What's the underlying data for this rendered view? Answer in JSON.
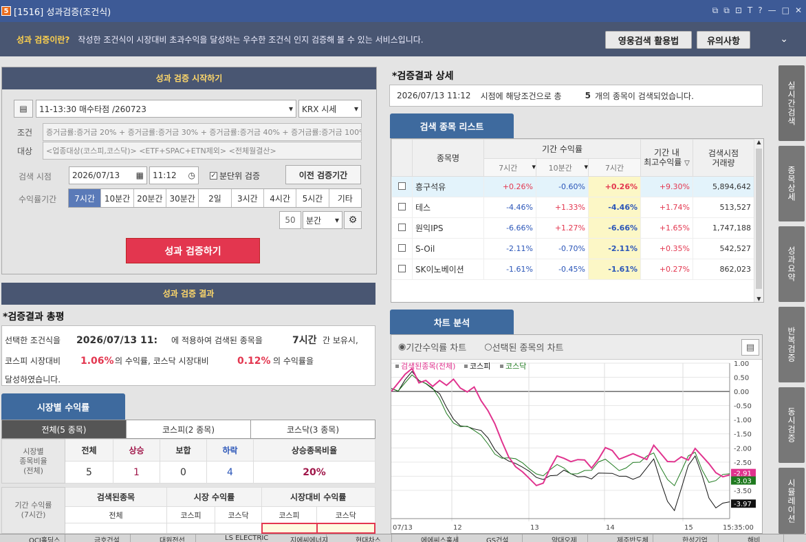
{
  "window": {
    "number": "5",
    "title": "[1516] 성과검증(조건식)",
    "icons": [
      "⧉",
      "⧉",
      "⊡",
      "T",
      "?",
      "—",
      "□",
      "✕"
    ]
  },
  "info": {
    "question": "성과 검증이란?",
    "desc": "작성한 조건식이 시장대비 초과수익을 달성하는 우수한 조건식 인지 검증해 볼 수 있는 서비스입니다.",
    "btn_video": "영웅검색 활용법",
    "btn_caution": "유의사항",
    "collapse": "⌄"
  },
  "start": {
    "header": "성과 검증 시작하기",
    "formula": "11-13:30 매수타점 /260723",
    "price_type": "KRX 시세",
    "cond_label": "조건",
    "cond_value": "증거금률:증거금 20% + 증거금률:증거금 30% + 증거금률:증거금 40% + 증거금률:증거금 100% + 주가범위",
    "target_label": "대상",
    "target_value": "<업종대상(코스피,코스닥)> <ETF+SPAC+ETN제외> <전체월결산>",
    "search_time_label": "검색 시점",
    "date": "2026/07/13",
    "time": "11:12",
    "minute_check": "분단위 검증",
    "prev_btn": "이전 검증기간",
    "period_label": "수익률기간",
    "periods": [
      "7시간",
      "10분간",
      "20분간",
      "30분간",
      "2일",
      "3시간",
      "4시간",
      "5시간",
      "기타"
    ],
    "custom_num": "50",
    "custom_unit": "분간",
    "run_btn": "성과 검증하기"
  },
  "result": {
    "header": "성과 검증 결과",
    "summary_title": "*검증결과 총평",
    "line1_pre": "선택한 조건식을",
    "line1_date": "2026/07/13  11:",
    "line1_mid": "에 적용하여 검색된 종목을",
    "line1_period": "7시간",
    "line1_post": "간 보유시,",
    "line2_pre": "코스피 시장대비",
    "line2_kospi": "1.06%",
    "line2_mid": "의 수익률, 코스닥 시장대비",
    "line2_kosdaq": "0.12%",
    "line2_post": "의 수익률을",
    "line3": "달성하였습니다."
  },
  "market": {
    "tab": "시장별 수익률",
    "subtabs": [
      "전체(5 종목)",
      "코스피(2 종목)",
      "코스닥(3 종목)"
    ],
    "row_label": "시장별\n종목비율\n(전체)",
    "headers": [
      "전체",
      "상승",
      "보합",
      "하락",
      "상승종목비율"
    ],
    "values": [
      "5",
      "1",
      "0",
      "4",
      "20%"
    ],
    "period_label": "기간 수익률\n(7시간)",
    "h2": [
      "검색된종목",
      "시장 수익률",
      "시장대비 수익률"
    ],
    "h3": [
      "전체",
      "코스피",
      "코스닥",
      "코스피",
      "코스닥"
    ]
  },
  "detail": {
    "title": "*검증결과 상세",
    "date": "2026/07/13 11:12",
    "text1": "시점에 해당조건으로 총",
    "count": "5",
    "text2": "개의 종목이 검색되었습니다."
  },
  "stock_list": {
    "tab": "검색 종목 리스트",
    "h_name": "종목명",
    "h_period": "기간 수익률",
    "h_max": "기간 내\n최고수익률",
    "h_vol": "검색시점\n거래량",
    "sub": [
      "7시간",
      "10분간",
      "7시간"
    ],
    "rows": [
      {
        "name": "흥구석유",
        "r1": "+0.26%",
        "r2": "-0.60%",
        "r3": "+0.26%",
        "max": "+9.30%",
        "vol": "5,894,642"
      },
      {
        "name": "테스",
        "r1": "-4.46%",
        "r2": "+1.33%",
        "r3": "-4.46%",
        "max": "+1.74%",
        "vol": "513,527"
      },
      {
        "name": "원익IPS",
        "r1": "-6.66%",
        "r2": "+1.27%",
        "r3": "-6.66%",
        "max": "+1.65%",
        "vol": "1,747,188"
      },
      {
        "name": "S-Oil",
        "r1": "-2.11%",
        "r2": "-0.70%",
        "r3": "-2.11%",
        "max": "+0.35%",
        "vol": "542,527"
      },
      {
        "name": "SK이노베이션",
        "r1": "-1.61%",
        "r2": "-0.45%",
        "r3": "-1.61%",
        "max": "+0.27%",
        "vol": "862,023"
      }
    ]
  },
  "chart_panel": {
    "tab": "차트 분석",
    "radio1": "기간수익률 차트",
    "radio2": "선택된 종목의 차트"
  },
  "chart_data": {
    "type": "line",
    "legend": [
      "검색된종목(전체)",
      "코스피",
      "코스닥"
    ],
    "y_ticks": [
      "1.00",
      "0.50",
      "0.00",
      "-0.50",
      "-1.00",
      "-1.50",
      "-2.00",
      "-2.50",
      "-3.00",
      "-3.50"
    ],
    "ylim": [
      -4.5,
      1.0
    ],
    "x_ticks": [
      "07/13",
      "12",
      "13",
      "14",
      "15",
      "15:35:00"
    ],
    "end_labels": [
      "-3.03",
      "-3.97"
    ],
    "top_label": "-2.91",
    "colors": {
      "searched": "#e0338e",
      "kospi": "#111111",
      "kosdaq": "#1f7a1f"
    },
    "series": [
      {
        "name": "검색된종목(전체)",
        "values": [
          0.0,
          0.2,
          0.5,
          0.8,
          0.4,
          0.5,
          0.2,
          0.3,
          0.1,
          0.4,
          0.2,
          0.1,
          0.2,
          -0.4,
          -0.8,
          -1.2,
          -1.7,
          -2.2,
          -2.6,
          -2.9,
          -3.2,
          -3.4,
          -3.2,
          -2.6,
          -2.2,
          -2.4,
          -2.6,
          -2.5,
          -2.4,
          -2.6,
          -2.3,
          -2.0,
          -2.2,
          -2.5,
          -2.3,
          -2.1,
          -2.2,
          -2.4,
          -2.0,
          -2.3,
          -2.5,
          -2.4,
          -2.2,
          -2.4,
          -2.1,
          -2.4,
          -2.6,
          -2.8,
          -2.9,
          -2.9
        ]
      },
      {
        "name": "코스피",
        "values": [
          0.0,
          -0.1,
          0.4,
          0.8,
          0.5,
          0.3,
          0.0,
          -0.2,
          -0.6,
          -0.9,
          -1.1,
          -1.2,
          -1.4,
          -1.5,
          -1.7,
          -2.0,
          -2.2,
          -2.4,
          -2.6,
          -2.8,
          -2.9,
          -3.0,
          -3.0,
          -2.9,
          -3.0,
          -2.9,
          -3.0,
          -3.0,
          -2.9,
          -3.0,
          -2.9,
          -3.0,
          -3.0,
          -3.0,
          -2.9,
          -3.0,
          -3.0,
          -2.8,
          -2.5,
          -3.2,
          -3.8,
          -4.1,
          -3.4,
          -2.7,
          -2.4,
          -3.0,
          -3.7,
          -4.0,
          -3.9,
          -3.97
        ]
      },
      {
        "name": "코스닥",
        "values": [
          0.0,
          0.0,
          0.4,
          0.7,
          0.4,
          0.2,
          0.0,
          -0.3,
          -0.7,
          -1.0,
          -1.2,
          -1.3,
          -1.5,
          -1.6,
          -1.8,
          -2.1,
          -2.3,
          -2.4,
          -2.5,
          -2.6,
          -2.7,
          -2.8,
          -2.9,
          -2.8,
          -2.7,
          -2.8,
          -2.9,
          -2.8,
          -2.7,
          -2.8,
          -2.6,
          -2.5,
          -2.6,
          -2.7,
          -2.6,
          -2.5,
          -2.6,
          -2.4,
          -2.2,
          -2.6,
          -3.0,
          -3.3,
          -2.9,
          -2.4,
          -2.2,
          -2.7,
          -3.1,
          -3.1,
          -3.0,
          -3.03
        ]
      }
    ]
  },
  "side": [
    "실시간검색",
    "종목상세",
    "성과요약",
    "반복검증",
    "동시검증",
    "시뮬레이션"
  ],
  "taskbar": [
    "OCI홀딩스",
    "금호건설",
    "대원전선",
    "LS ELECTRIC",
    "지에씨에너지",
    "현대차스",
    "에에씨스훌세",
    "GS건설",
    "약대오제",
    "제주반도체",
    "한성기업",
    "해비"
  ]
}
